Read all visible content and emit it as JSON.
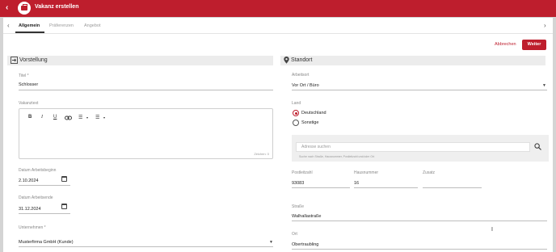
{
  "app": {
    "title": "Vakanz erstellen",
    "back_icon": "‹"
  },
  "tabs": [
    {
      "label": "Allgemein"
    },
    {
      "label": "Präferenzen"
    },
    {
      "label": "Angebot"
    }
  ],
  "actions": {
    "cancel": "Abbrechen",
    "next": "Weiter"
  },
  "left": {
    "section_title": "Vorstellung",
    "title_label": "Titel *",
    "title_value": "Schlosser",
    "text_label": "Vakanztext",
    "editor_toolbar": {
      "bold": "B",
      "italic": "I",
      "underline": "U",
      "link": "🔗",
      "bullets": "☰",
      "numbers": "☰",
      "caret": "▾"
    },
    "char_counter": "Zeichen: 0",
    "start_label": "Datum Arbeitsbeginn",
    "start_value": "2.10.2024",
    "end_label": "Datum Arbeitsende",
    "end_value": "31.12.2024",
    "company_label": "Unternehmen *",
    "company_value": "Musterfirma GmbH (Kunde)"
  },
  "right": {
    "section_title": "Standort",
    "workplace_label": "Arbeitsort",
    "workplace_value": "Vor Ort / Büro",
    "country_label": "Land",
    "country_options": [
      {
        "label": "Deutschland",
        "selected": true
      },
      {
        "label": "Sonstige",
        "selected": false
      }
    ],
    "search_placeholder": "Adresse suchen",
    "search_hint": "Suche nach Straße, Hausnummer, Postleitzahl und/oder Ort",
    "zip_label": "Postleitzahl",
    "zip_value": "93083",
    "house_label": "Hausnummer",
    "house_value": "16",
    "extra_label": "Zusatz",
    "extra_value": "",
    "street_label": "Straße",
    "street_value": "Walhallastraße",
    "city_label": "Ort",
    "city_value": "Obertraubling"
  },
  "colors": {
    "brand": "#be1e2d",
    "section_bg": "#ececec"
  }
}
